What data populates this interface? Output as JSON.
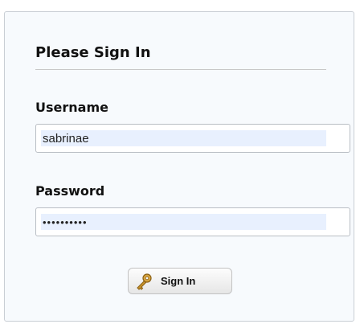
{
  "form": {
    "title": "Please Sign In",
    "username_label": "Username",
    "username_value": "sabrinae",
    "password_label": "Password",
    "password_value": "••••••••••",
    "submit_label": "Sign In"
  },
  "icons": {
    "submit_icon": "key-icon"
  },
  "colors": {
    "panel_bg": "#f7fafd",
    "autofill_bg": "#e8f0fe",
    "key_gold": "#c8942c"
  }
}
